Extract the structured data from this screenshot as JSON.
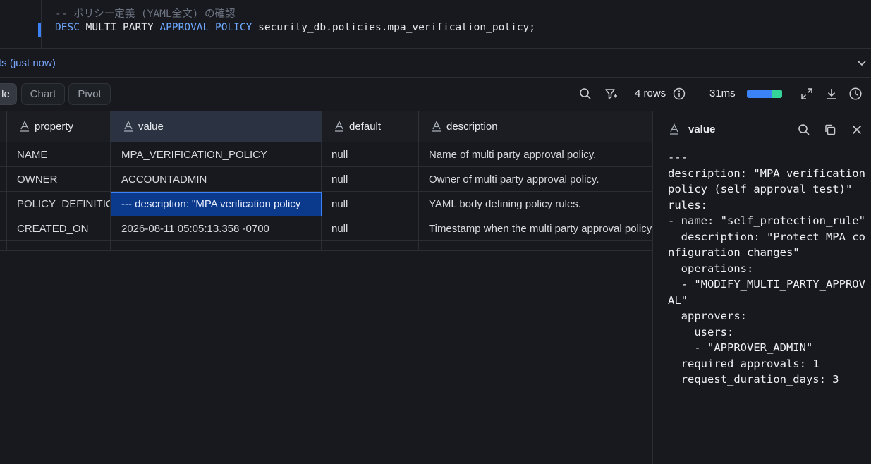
{
  "editor": {
    "comment_line": "-- ポリシー定義 (YAML全文) の確認",
    "statement": {
      "kw_desc": "DESC",
      "kw_multi_party": "MULTI PARTY",
      "kw_approval_policy": "APPROVAL POLICY",
      "target": "security_db.policies.mpa_verification_policy;"
    }
  },
  "results": {
    "tab_label": "ts (just now)"
  },
  "toolbar": {
    "tabs": [
      "le",
      "Chart",
      "Pivot"
    ],
    "active_tab": "le",
    "row_count": "4 rows",
    "duration": "31ms",
    "timing_split": [
      0.72,
      0.28
    ],
    "colors": {
      "accent": "#3b82f6",
      "secondary": "#34d399"
    }
  },
  "table": {
    "columns": [
      "property",
      "value",
      "default",
      "description"
    ],
    "selected_column": "value",
    "rows": [
      [
        "NAME",
        "MPA_VERIFICATION_POLICY",
        "null",
        "Name of multi party approval policy."
      ],
      [
        "OWNER",
        "ACCOUNTADMIN",
        "null",
        "Owner of multi party approval policy."
      ],
      [
        "POLICY_DEFINITION",
        "--- description: \"MPA verification policy",
        "null",
        "YAML body defining policy rules."
      ],
      [
        "CREATED_ON",
        "2026-08-11 05:05:13.358 -0700",
        "null",
        "Timestamp when the multi party approval policy was created."
      ]
    ]
  },
  "panel": {
    "title": "value",
    "content": "---\ndescription: \"MPA verification policy (self approval test)\"\nrules:\n- name: \"self_protection_rule\"\n  description: \"Protect MPA configuration changes\"\n  operations:\n  - \"MODIFY_MULTI_PARTY_APPROVAL\"\n  approvers:\n    users:\n    - \"APPROVER_ADMIN\"\n  required_approvals: 1\n  request_duration_days: 3"
  }
}
